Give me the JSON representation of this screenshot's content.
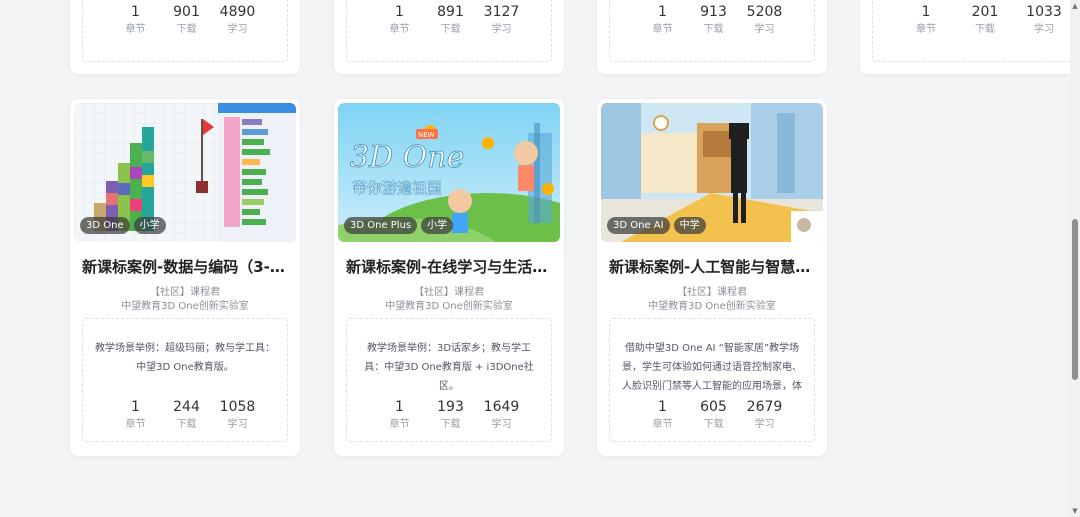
{
  "labels": {
    "chapters": "章节",
    "downloads": "下载",
    "learners": "学习"
  },
  "top_cards": [
    {
      "chapters": "1",
      "downloads": "901",
      "learners": "4890"
    },
    {
      "chapters": "1",
      "downloads": "891",
      "learners": "3127"
    },
    {
      "chapters": "1",
      "downloads": "913",
      "learners": "5208"
    },
    {
      "chapters": "1",
      "downloads": "201",
      "learners": "1033"
    }
  ],
  "cards": [
    {
      "tags": [
        "3D One",
        "小学"
      ],
      "title": "新课标案例-数据与编码（3-4…",
      "author": "【社区】课程君",
      "org": "中望教育3D One创新实验室",
      "desc": "教学场景举例：超级玛丽；教与学工具：中望3D One教育版。",
      "chapters": "1",
      "downloads": "244",
      "learners": "1058"
    },
    {
      "tags": [
        "3D One Plus",
        "小学"
      ],
      "title": "新课标案例-在线学习与生活…",
      "author": "【社区】课程君",
      "org": "中望教育3D One创新实验室",
      "desc": "教学场景举例：3D话家乡；教与学工具：中望3D One教育版 + i3DOne社区。",
      "chapters": "1",
      "downloads": "193",
      "learners": "1649",
      "banner_line1": "3D One",
      "banner_line2": "带你游遍祖国",
      "banner_badge": "NEW"
    },
    {
      "tags": [
        "3D One AI",
        "中学"
      ],
      "title": "新课标案例-人工智能与智慧…",
      "author": "【社区】课程君",
      "org": "中望教育3D One创新实验室",
      "desc": "借助中望3D One AI “智能家居”教学场景，学生可体验如何通过语音控制家电、人脸识别门禁等人工智能的应用场景，体",
      "chapters": "1",
      "downloads": "605",
      "learners": "2679"
    }
  ],
  "colors": {
    "page_bg": "#f3f4f6",
    "card_bg": "#ffffff",
    "tag_bg": "#3c3c3c"
  }
}
